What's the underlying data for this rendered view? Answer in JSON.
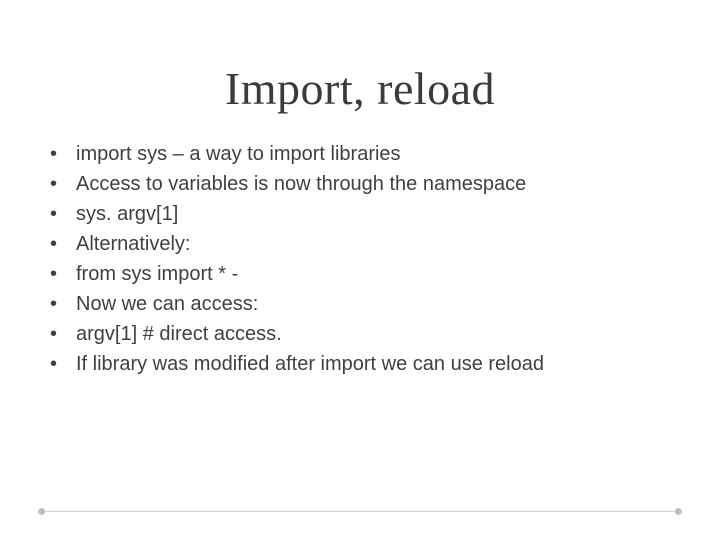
{
  "slide": {
    "title": "Import, reload",
    "bullets": [
      "import sys – a way to import libraries",
      "Access to variables is now through the namespace",
      "sys. argv[1]",
      "Alternatively:",
      "from sys import * -",
      "Now we can access:",
      "argv[1] # direct access.",
      "If library was modified after import we can use reload"
    ]
  }
}
